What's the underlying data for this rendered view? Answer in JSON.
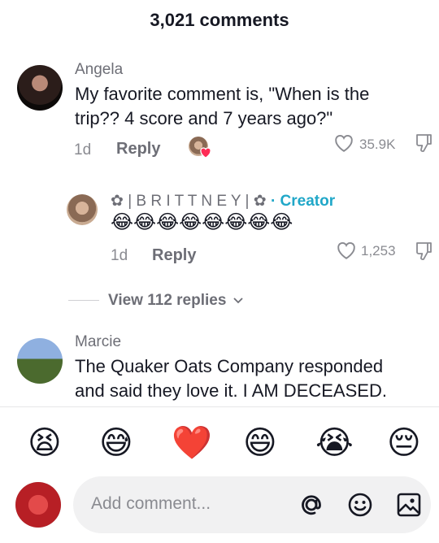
{
  "header": {
    "title": "3,021 comments"
  },
  "comments": [
    {
      "name": "Angela",
      "text_line1": "My favorite comment is, \"When is the",
      "text_line2": "trip?? 4 score and 7 years ago?\"",
      "age": "1d",
      "reply_label": "Reply",
      "likes": "35.9K"
    },
    {
      "name": "✿ | B R I T T N E Y | ✿",
      "creator_label": "· Creator",
      "text": "😂😂😂😂😂😂😂😂",
      "age": "1d",
      "reply_label": "Reply",
      "likes": "1,253"
    },
    {
      "name": "Marcie",
      "text_line1": "The Quaker Oats Company responded",
      "text_line2": "and said they love it. I AM DECEASED."
    }
  ],
  "view_replies": {
    "label": "View 112 replies"
  },
  "emoji_bar": [
    "😫",
    "😅",
    "❤️",
    "😄",
    "😭",
    "😔"
  ],
  "composer": {
    "placeholder": "Add comment..."
  },
  "colors": {
    "accent": "#20a7c8",
    "heart": "#fe2c55"
  }
}
